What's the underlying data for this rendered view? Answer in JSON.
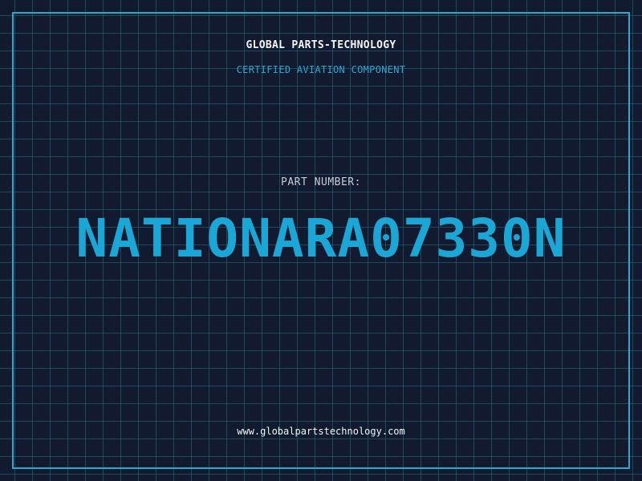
{
  "header": {
    "company": "GLOBAL PARTS-TECHNOLOGY",
    "subtitle": "CERTIFIED AVIATION COMPONENT"
  },
  "part": {
    "label": "PART NUMBER:",
    "number": "NATIONARA07330N"
  },
  "footer": {
    "website": "www.globalpartstechnology.com"
  },
  "colors": {
    "background": "#111a2e",
    "grid": "#286e82",
    "accent": "#2aa9cf",
    "part_number": "#1aa7d6",
    "text": "#f2f4f7"
  }
}
